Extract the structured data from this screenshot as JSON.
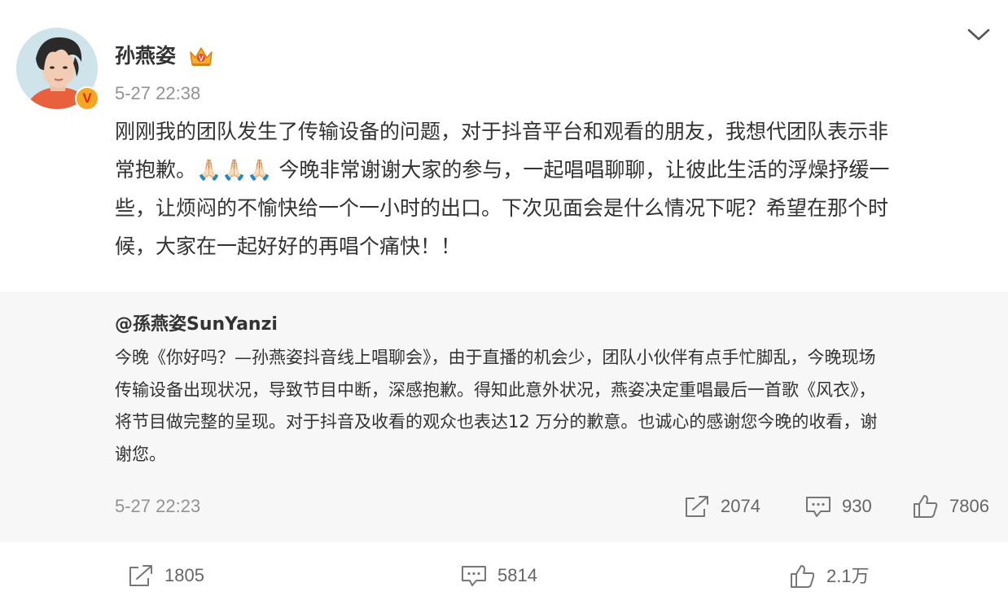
{
  "post": {
    "username": "孙燕姿",
    "timestamp": "5-27 22:38",
    "text": "刚刚我的团队发生了传输设备的问题，对于抖音平台和观看的朋友，我想代团队表示非\n常抱歉。🙏🏻🙏🏻🙏🏻 今晚非常谢谢大家的参与，一起唱唱聊聊，让彼此生活的浮燥抒缓一\n些，让烦闷的不愉快给一个一小时的出口。下次见面会是什么情况下呢？希望在那个时\n候，大家在一起好好的再唱个痛快！！",
    "icons": {
      "avatar_badge": "verified-v-badge",
      "crown": "crown-icon",
      "menu": "chevron-down-icon"
    }
  },
  "repost": {
    "author": "@孫燕姿SunYanzi",
    "text": "今晚《你好吗？—孙燕姿抖音线上唱聊会》，由于直播的机会少，团队小伙伴有点手忙脚乱，今晚现场\n传输设备出现状况，导致节目中断，深感抱歉。得知此意外状况，燕姿决定重唱最后一首歌《风衣》，\n将节目做完整的呈现。对于抖音及收看的观众也表达12 万分的歉意。也诚心的感谢您今晚的收看，谢\n谢您。",
    "timestamp": "5-27 22:23",
    "share_count": "2074",
    "comment_count": "930",
    "like_count": "7806"
  },
  "actions": {
    "share_count": "1805",
    "comment_count": "5814",
    "like_count": "2.1万"
  },
  "badge_letter": "V",
  "colors": {
    "text": "#333333",
    "muted": "#939393",
    "repost_bg": "#f7f7f7",
    "badge": "#f5a623"
  }
}
